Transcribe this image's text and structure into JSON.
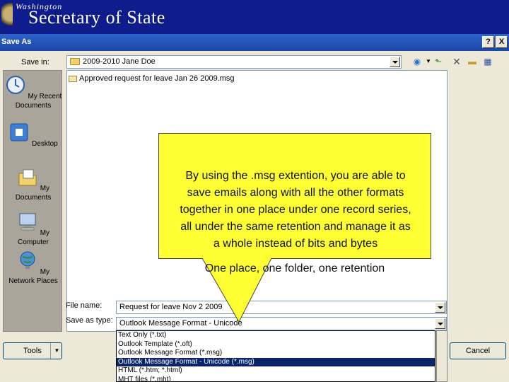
{
  "banner": {
    "state_small": "Washington",
    "state_big": "Secretary of State"
  },
  "dialog": {
    "title": "Save As",
    "help_button": "?",
    "close_button": "X",
    "save_in_label": "Save in:",
    "save_in_value": "2009-2010 Jane Doe",
    "places": [
      "My Recent Documents",
      "Desktop",
      "My Documents",
      "My Computer",
      "My Network Places"
    ],
    "files": [
      "Approved request for leave Jan 26 2009.msg"
    ],
    "file_name_label": "File name:",
    "file_name_value": "Request for leave Nov 2 2009",
    "save_as_type_label": "Save as type:",
    "save_as_type_value": "Outlook Message Format - Unicode",
    "type_options": [
      "Text Only (*.txt)",
      "Outlook Template (*.oft)",
      "Outlook Message Format (*.msg)",
      "Outlook Message Format - Unicode (*.msg)",
      "HTML (*.htm; *.html)",
      "MHT files (*.mht)"
    ],
    "selected_type_index": 3,
    "tools_label": "Tools",
    "cancel_label": "Cancel"
  },
  "callout": {
    "line1": "By using the .msg extention, you are able to",
    "line2": "save emails along with all the other formats",
    "line3": "together in one place under one record series,",
    "line4": "all under the same retention and manage it as",
    "line5": "a whole instead of bits and bytes",
    "line6": "One place, one folder, one retention",
    "color": "#ffff33"
  }
}
